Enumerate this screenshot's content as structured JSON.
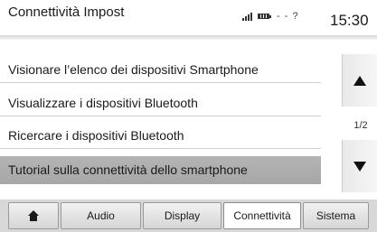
{
  "header": {
    "title": "Connettività Impost",
    "network_indicator": "- - ?",
    "clock": "15:30",
    "icons": [
      "signal-icon",
      "battery-icon",
      "network-icon"
    ]
  },
  "menu": {
    "items": [
      {
        "label": "Visionare l’elenco dei dispositivi Smartphone"
      },
      {
        "label": "Visualizzare i dispositivi Bluetooth"
      },
      {
        "label": "Ricercare i dispositivi Bluetooth"
      },
      {
        "label": "Tutorial sulla connettività dello smartphone",
        "selected": true
      }
    ]
  },
  "pager": {
    "page": "1/2",
    "up_icon": "arrow-up-icon",
    "down_icon": "arrow-down-icon"
  },
  "tabs": {
    "home_icon": "home-icon",
    "items": [
      {
        "label": "Audio"
      },
      {
        "label": "Display"
      },
      {
        "label": "Connettività",
        "active": true
      },
      {
        "label": "Sistema"
      }
    ]
  },
  "colors": {
    "selected_row": "#ababab",
    "active_tab": "#ffffff",
    "tab_bar": "#d8d8d8"
  }
}
